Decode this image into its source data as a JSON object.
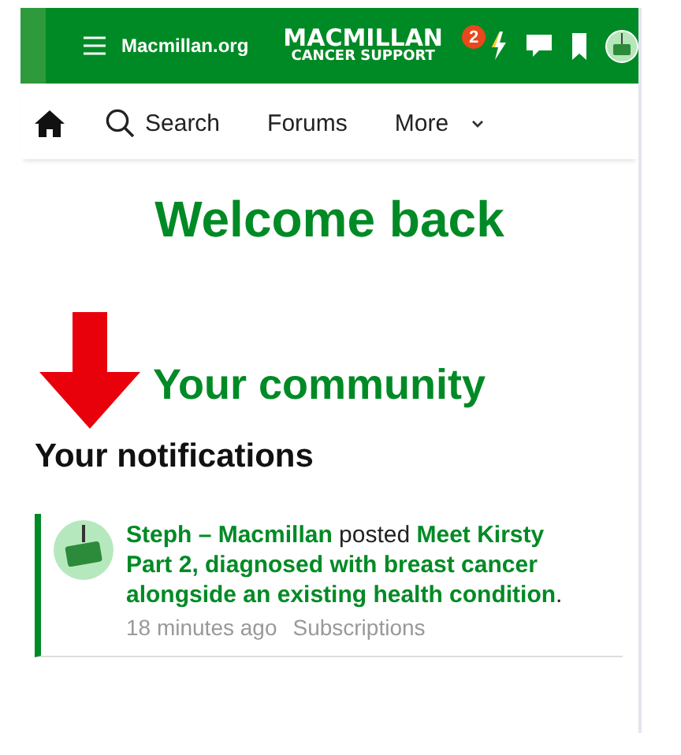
{
  "header": {
    "site_link": "Macmillan.org",
    "logo": [
      "MACMILLAN",
      "CANCER SUPPORT"
    ],
    "notification_count": "2"
  },
  "nav": [
    {
      "kind": "home"
    },
    {
      "kind": "search",
      "label": "Search"
    },
    {
      "kind": "link",
      "label": "Forums"
    },
    {
      "kind": "menu",
      "label": "More"
    }
  ],
  "welcome": "Welcome back",
  "community": "Your community",
  "notifications_heading": "Your notifications",
  "notifications": [
    {
      "text": "**Steph – Macmillan** posted **Meet Kirsty Part 2, diagnosed with breast cancer alongside an existing health condition**.",
      "time": "18 minutes ago",
      "source": "Subscriptions"
    }
  ]
}
